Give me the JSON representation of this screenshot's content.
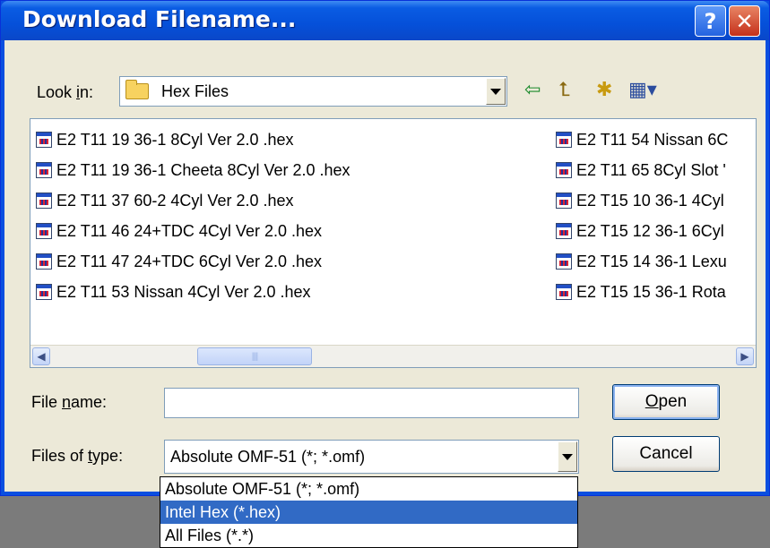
{
  "window": {
    "title": "Download Filename...",
    "help_label": "?",
    "close_label": "✕"
  },
  "lookin": {
    "label_pre": "Look ",
    "label_key": "i",
    "label_post": "n:",
    "value": "Hex Files"
  },
  "toolbar": {
    "back_icon": "⇦",
    "up_icon": "⮤",
    "new_folder_icon": "✱",
    "view_icon": "▦▾"
  },
  "files": [
    {
      "name": "E2 T11 19 36-1 8Cyl Ver 2.0 .hex"
    },
    {
      "name": "E2 T11 19 36-1 Cheeta 8Cyl Ver 2.0 .hex"
    },
    {
      "name": "E2 T11 37 60-2 4Cyl Ver 2.0 .hex"
    },
    {
      "name": "E2 T11 46 24+TDC 4Cyl Ver 2.0 .hex"
    },
    {
      "name": "E2 T11 47 24+TDC 6Cyl Ver 2.0 .hex"
    },
    {
      "name": "E2 T11 53 Nissan 4Cyl Ver 2.0 .hex"
    },
    {
      "name": "E2 T11 54 Nissan 6C"
    },
    {
      "name": "E2 T11 65 8Cyl Slot '"
    },
    {
      "name": "E2 T15 10 36-1 4Cyl"
    },
    {
      "name": "E2 T15 12 36-1 6Cyl"
    },
    {
      "name": "E2 T15 14 36-1 Lexu"
    },
    {
      "name": "E2 T15 15 36-1 Rota"
    }
  ],
  "scrollbar": {
    "left_arrow": "◀",
    "right_arrow": "▶",
    "grip": "||||"
  },
  "filename": {
    "label_pre": "File ",
    "label_key": "n",
    "label_post": "ame:",
    "value": ""
  },
  "filetype": {
    "label_pre": "Files of ",
    "label_key": "t",
    "label_post": "ype:",
    "value": "Absolute OMF-51 (*; *.omf)",
    "options": [
      "Absolute OMF-51 (*; *.omf)",
      "Intel Hex (*.hex)",
      "All Files (*.*)"
    ],
    "highlighted_index": 1
  },
  "buttons": {
    "open_key": "O",
    "open_rest": "pen",
    "cancel": "Cancel"
  }
}
